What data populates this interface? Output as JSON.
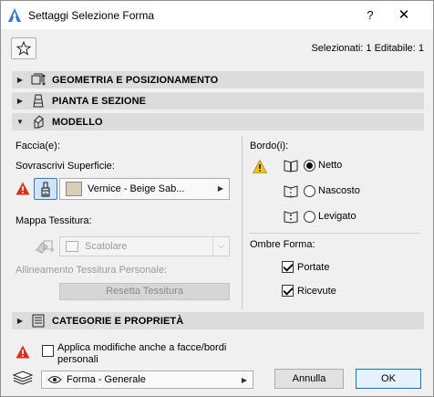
{
  "window": {
    "title": "Settaggi Selezione Forma",
    "help_glyph": "?",
    "close_glyph": "✕"
  },
  "header": {
    "favorites_icon": "star-icon",
    "selection_info": "Selezionati: 1 Editabile: 1"
  },
  "sections": {
    "geometry": {
      "title": "GEOMETRIA E POSIZIONAMENTO",
      "expanded": false,
      "icon": "geometry-icon"
    },
    "plan": {
      "title": "PIANTA E SEZIONE",
      "expanded": false,
      "icon": "plan-section-icon"
    },
    "model": {
      "title": "MODELLO",
      "expanded": true,
      "icon": "model-icon"
    },
    "categories": {
      "title": "CATEGORIE E PROPRIETÀ",
      "expanded": false,
      "icon": "categories-icon"
    }
  },
  "model": {
    "faces_label": "Faccia(e):",
    "override_label": "Sovrascrivi Superficie:",
    "surface_value": "Vernice - Beige Sab...",
    "surface_color": "#d8ceb7",
    "texture_map_label": "Mappa Tessitura:",
    "texture_map_value": "Scatolare",
    "custom_alignment_label": "Allineamento Tessitura Personale:",
    "reset_texture_label": "Resetta Tessitura",
    "edges_label": "Bordo(i):",
    "edge_options": [
      {
        "label": "Netto",
        "selected": true
      },
      {
        "label": "Nascosto",
        "selected": false
      },
      {
        "label": "Levigato",
        "selected": false
      }
    ],
    "shadows_label": "Ombre Forma:",
    "cast_label": "Portate",
    "cast_checked": true,
    "receive_label": "Ricevute",
    "receive_checked": true
  },
  "footer": {
    "apply_line1": "Applica modifiche anche a facce/bordi",
    "apply_line2": "personali",
    "apply_checked": false,
    "layer_value": "Forma - Generale",
    "cancel_label": "Annulla",
    "ok_label": "OK"
  },
  "colors": {
    "warning": "#f0c419",
    "warning_red": "#d9301f",
    "accent": "#0078d7"
  }
}
